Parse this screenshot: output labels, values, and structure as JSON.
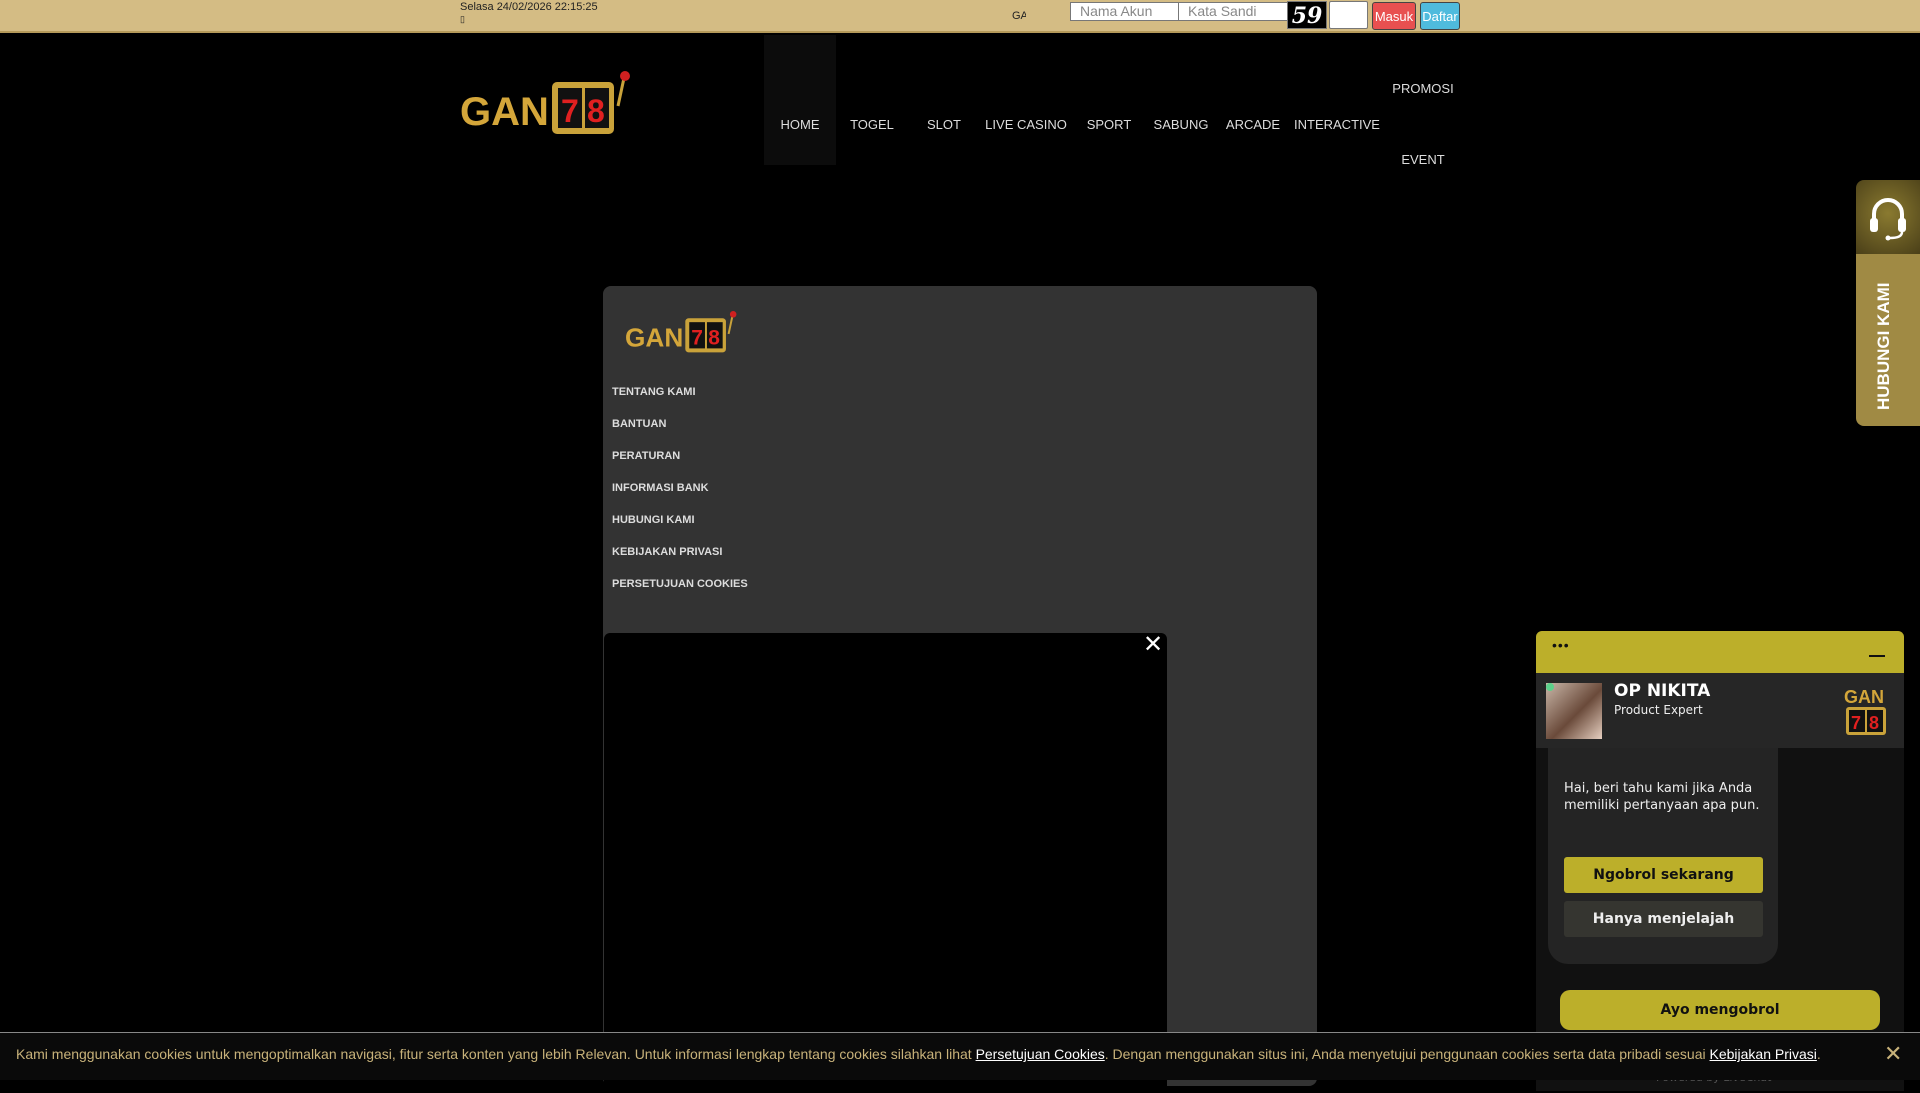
{
  "topbar": {
    "datetime": "Selasa 24/02/2026 22:15:25",
    "glyph": "▯",
    "marquee": "GA",
    "username_placeholder": "Nama Akun",
    "password_placeholder": "Kata Sandi",
    "captcha": "59",
    "login": "Masuk",
    "register": "Daftar"
  },
  "brand": {
    "logo_text": "GAN",
    "logo_num": "78"
  },
  "nav": [
    "HOME",
    "TOGEL",
    "SLOT",
    "LIVE CASINO",
    "SPORT",
    "SABUNG",
    "ARCADE",
    "INTERACTIVE",
    "PROMOSI",
    "EVENT"
  ],
  "panel": {
    "links": [
      "TENTANG KAMI",
      "BANTUAN",
      "PERATURAN",
      "INFORMASI BANK",
      "HUBUNGI KAMI",
      "KEBIJAKAN PRIVASI",
      "PERSETUJUAN COOKIES"
    ],
    "close": "✕"
  },
  "side_tab": {
    "label": "HUBUNGI KAMI"
  },
  "chat": {
    "menu": "•••",
    "agent_name": "OP NIKITA",
    "agent_role": "Product Expert",
    "message": "Hai, beri tahu kami jika Anda memiliki pertanyaan apa pun.",
    "btn_chat": "Ngobrol sekarang",
    "btn_browse": "Hanya menjelajah",
    "btn_start": "Ayo mengobrol",
    "powered": "Powered by LiveChat"
  },
  "cookie": {
    "text1": "Kami menggunakan cookies untuk mengoptimalkan navigasi, fitur serta konten yang lebih Relevan. Untuk informasi lengkap tentang cookies silahkan lihat ",
    "link1": "Persetujuan Cookies",
    "text2": ". Dengan menggunakan situs ini, Anda menyetujui penggunaan cookies serta data pribadi sesuai ",
    "link2": "Kebijakan Privasi",
    "text3": ".",
    "close": "✕"
  }
}
